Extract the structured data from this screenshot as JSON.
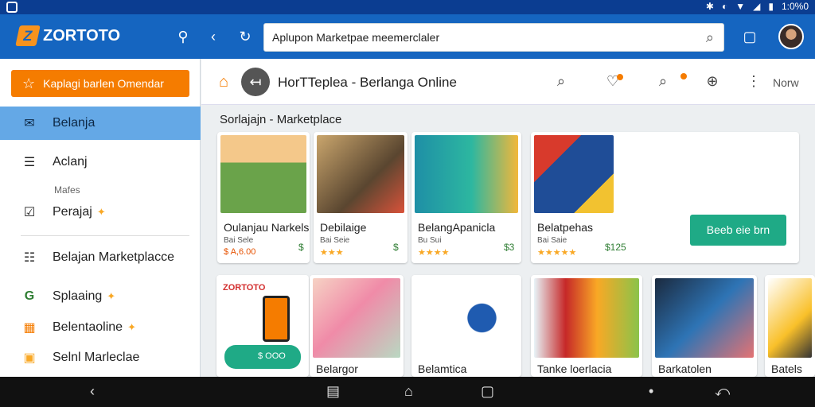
{
  "status_bar": {
    "time": "1:0%0"
  },
  "app": {
    "brand": "ZORTOTO",
    "search": {
      "value": "Aplupon Marketpae meemerclaler"
    }
  },
  "sidebar": {
    "cta_label": "Kaplagi barlen Omendar",
    "items": [
      {
        "label": "Belanja"
      },
      {
        "label": "Aclanj"
      },
      {
        "label": "Perajaj"
      },
      {
        "label": "Belajan Marketplacce"
      },
      {
        "label": "Splaaing"
      },
      {
        "label": "Belentaoline"
      },
      {
        "label": "Selnl Marleclae"
      }
    ],
    "section_label": "Mafes"
  },
  "main": {
    "title": "HorTTeplea - Berlanga Online",
    "more_label": "Norw",
    "section_title": "Sorlajajn - Marketplace",
    "buy_button": "Beeb eie brn",
    "row1": [
      {
        "name": "Oulanjau Narkels",
        "meta": "Bai Sele",
        "rating": "$ A,6.00",
        "price": "$"
      },
      {
        "name": "Debilaige",
        "meta": "Bai Seie",
        "rating": "★★★",
        "price": "$"
      },
      {
        "name": "BelangApanicla",
        "meta": "Bu Sui",
        "rating": "★★★★",
        "price": "$3"
      },
      {
        "name": "Belatpehas",
        "meta": "Bai Saie",
        "rating": "★★★★★",
        "price": "$125"
      }
    ],
    "row2": [
      {
        "name": "",
        "badge1": "ZORTOTO",
        "badge2": "$ OOO"
      },
      {
        "name": "Belargor"
      },
      {
        "name": "Belamtica"
      },
      {
        "name": "Tanke loerlacia"
      },
      {
        "name": "Barkatolen"
      },
      {
        "name": "Batels"
      }
    ]
  }
}
